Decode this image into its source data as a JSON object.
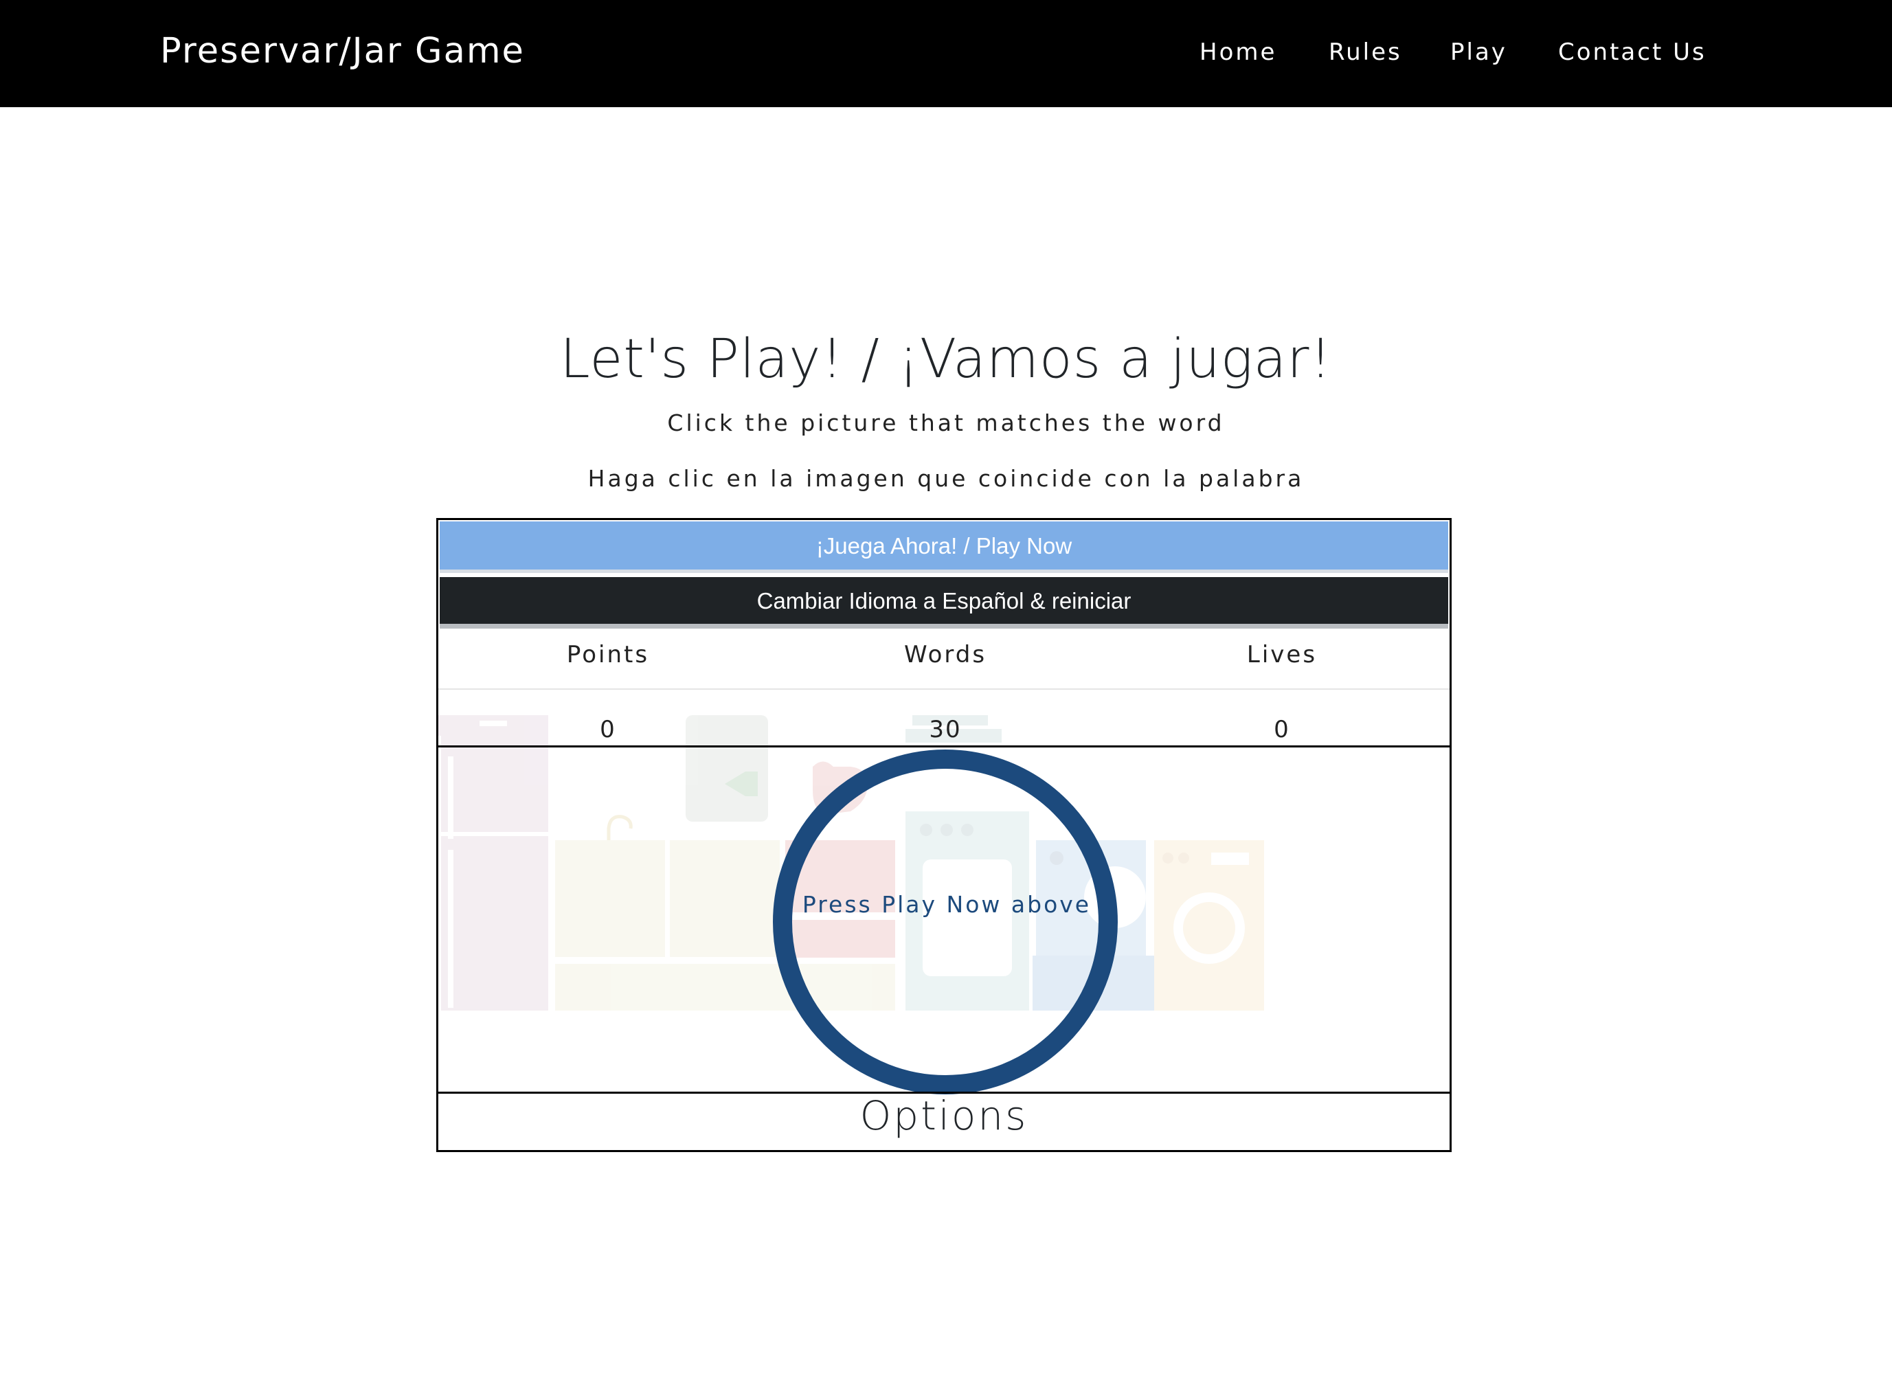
{
  "nav": {
    "brand": "Preservar/Jar Game",
    "links": [
      "Home",
      "Rules",
      "Play",
      "Contact Us"
    ]
  },
  "hero": {
    "title": "Let's Play! / ¡Vamos a jugar!",
    "instruction_en": "Click the picture that matches the word",
    "instruction_es": "Haga clic en la imagen que coincide con la palabra"
  },
  "game": {
    "play_button": "¡Juega Ahora! / Play Now",
    "language_button": "Cambiar Idioma a Español & reiniciar",
    "stats": {
      "headers": [
        "Points",
        "Words",
        "Lives"
      ],
      "values": [
        "0",
        "30",
        "0"
      ]
    },
    "prompt": "Press Play Now above",
    "options_heading": "Options"
  },
  "colors": {
    "navbar": "#000000",
    "play_button": "#7eaee7",
    "language_button": "#1f2326",
    "ring": "#1c4a7d"
  },
  "icons": [
    "kitchen-scene-illustration"
  ]
}
